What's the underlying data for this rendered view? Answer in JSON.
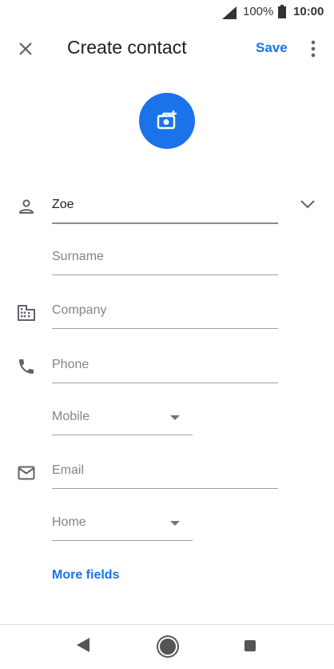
{
  "status_bar": {
    "battery": "100%",
    "time": "10:00"
  },
  "header": {
    "title": "Create contact",
    "save_label": "Save"
  },
  "form": {
    "first_name": {
      "value": "Zoe"
    },
    "surname": {
      "placeholder": "Surname"
    },
    "company": {
      "placeholder": "Company"
    },
    "phone": {
      "placeholder": "Phone"
    },
    "phone_type": {
      "value": "Mobile"
    },
    "email": {
      "placeholder": "Email"
    },
    "email_type": {
      "value": "Home"
    },
    "more_fields_label": "More fields"
  },
  "colors": {
    "accent": "#1a73e8",
    "text": "#202124",
    "placeholder": "#80868b"
  },
  "icons": [
    "close-icon",
    "more-vert-icon",
    "add-photo-icon",
    "person-icon",
    "chevron-down-icon",
    "business-icon",
    "phone-icon",
    "email-icon",
    "nav-back-icon",
    "nav-home-icon",
    "nav-recents-icon"
  ]
}
